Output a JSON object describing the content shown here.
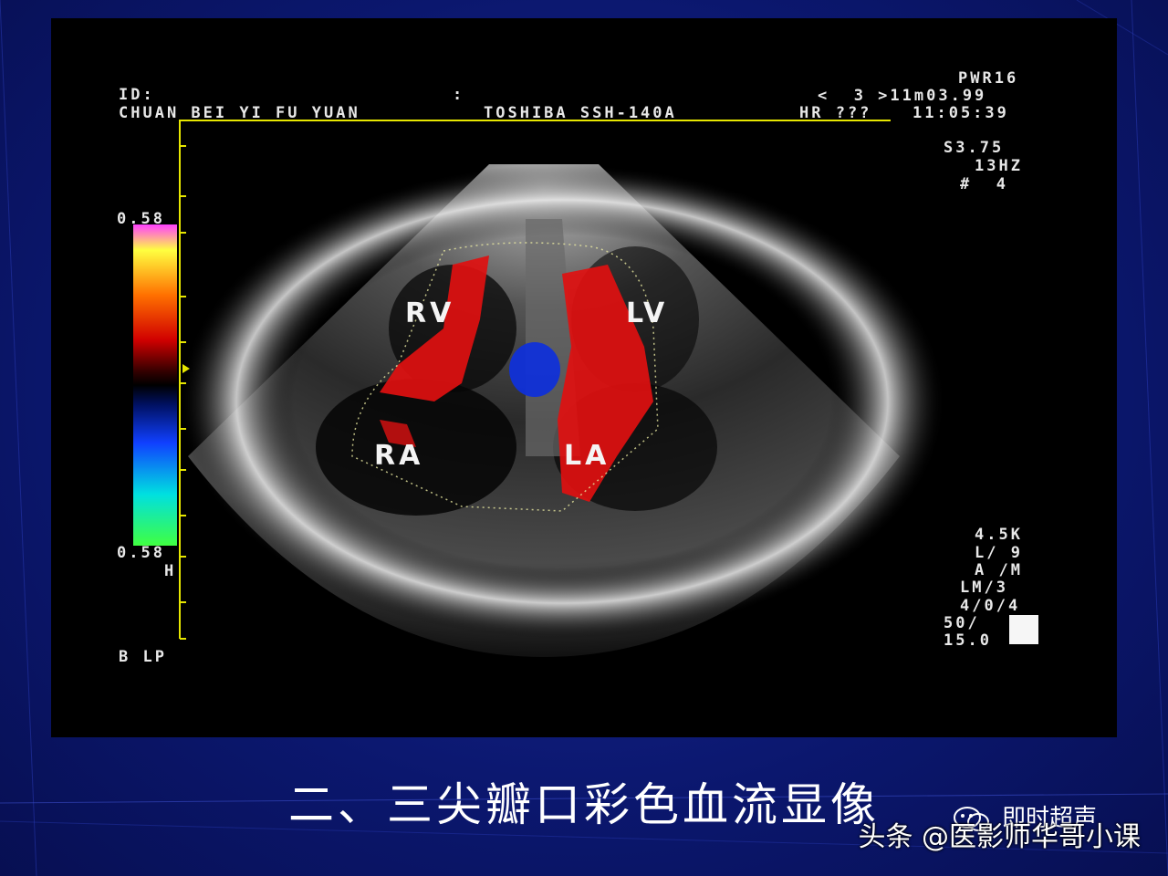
{
  "header": {
    "id_label": "ID:",
    "colon": ":",
    "hospital": "CHUAN BEI YI FU YUAN",
    "machine": "TOSHIBA SSH-140A",
    "power": "PWR16",
    "frame_info": "<  3 >11m03.99",
    "hr": "HR ???",
    "time": "11:05:39"
  },
  "right_top": {
    "s_value": "S3.75",
    "hz": "13HZ",
    "num": "#  4"
  },
  "scale": {
    "top_value": "0.58",
    "bottom_value": "0.58",
    "h": "H",
    "mode": "B LP"
  },
  "right_bottom": {
    "line1": "4.5K",
    "line2": "L/ 9",
    "line3": "A /M",
    "line4": "LM/3",
    "line5": "4/0/4",
    "line6": "50/",
    "line7": "15.0"
  },
  "chambers": {
    "rv": "RV",
    "lv": "LV",
    "ra": "RA",
    "la": "LA"
  },
  "caption": "二、三尖瓣口彩色血流显像",
  "wechat_label": "即时超声",
  "watermark": "头条 @医影师华哥小课",
  "colors": {
    "slide_bg": "#0d1a78",
    "scale_tick": "#e6e600",
    "flow_red": "#e01010",
    "flow_blue": "#1030d8"
  }
}
